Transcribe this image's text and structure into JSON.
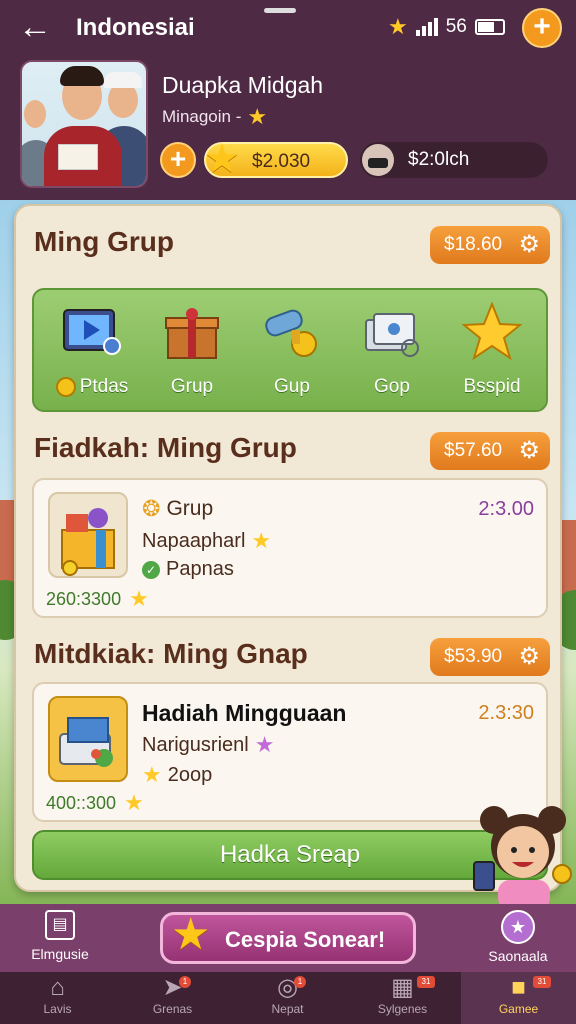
{
  "header": {
    "title": "Indonesiai",
    "signal_text": "56"
  },
  "profile": {
    "name": "Duapka Midgah",
    "subtitle": "Minagoin -",
    "coins": "$2.030",
    "cash": "$2:0lch"
  },
  "sections": [
    {
      "title": "Ming Grup",
      "price": "$18.60",
      "categories": [
        {
          "label": "Ptdas",
          "icon": "video-play-icon"
        },
        {
          "label": "Grup",
          "icon": "gift-box-icon"
        },
        {
          "label": "Gup",
          "icon": "scroll-coin-icon"
        },
        {
          "label": "Gop",
          "icon": "cards-icon"
        },
        {
          "label": "Bsspid",
          "icon": "gold-star-icon"
        }
      ]
    },
    {
      "title": "Fiadkah: Ming Grup",
      "price": "$57.60",
      "card": {
        "title": "Grup",
        "line2": "Napaapharl",
        "line3": "Papnas",
        "amount": "2:3.00",
        "count": "260:3300"
      }
    },
    {
      "title": "Mitdkiak: Ming Gnap",
      "price": "$53.90",
      "card": {
        "title": "Hadiah Mingguaan",
        "line2": "Narigusrienl",
        "line3": "2oop",
        "amount": "2.3:30",
        "count": "400::300"
      }
    }
  ],
  "cta_label": "Hadka Sreap",
  "action_bar": {
    "left_label": "Elmgusie",
    "main_label": "Cespia Sonear!",
    "right_label": "Saonaala"
  },
  "tabs": [
    {
      "label": "Lavis",
      "icon": "home-icon"
    },
    {
      "label": "Grenas",
      "icon": "rocket-icon"
    },
    {
      "label": "Nepat",
      "icon": "target-icon"
    },
    {
      "label": "Sylgenes",
      "icon": "grid-icon"
    },
    {
      "label": "Gamee",
      "icon": "game-icon"
    }
  ],
  "colors": {
    "header_bg": "#4f2a44",
    "accent_orange": "#f39a1e",
    "panel_bg": "#f2e8d6",
    "green": "#78b14c",
    "purple_button": "#953374"
  }
}
